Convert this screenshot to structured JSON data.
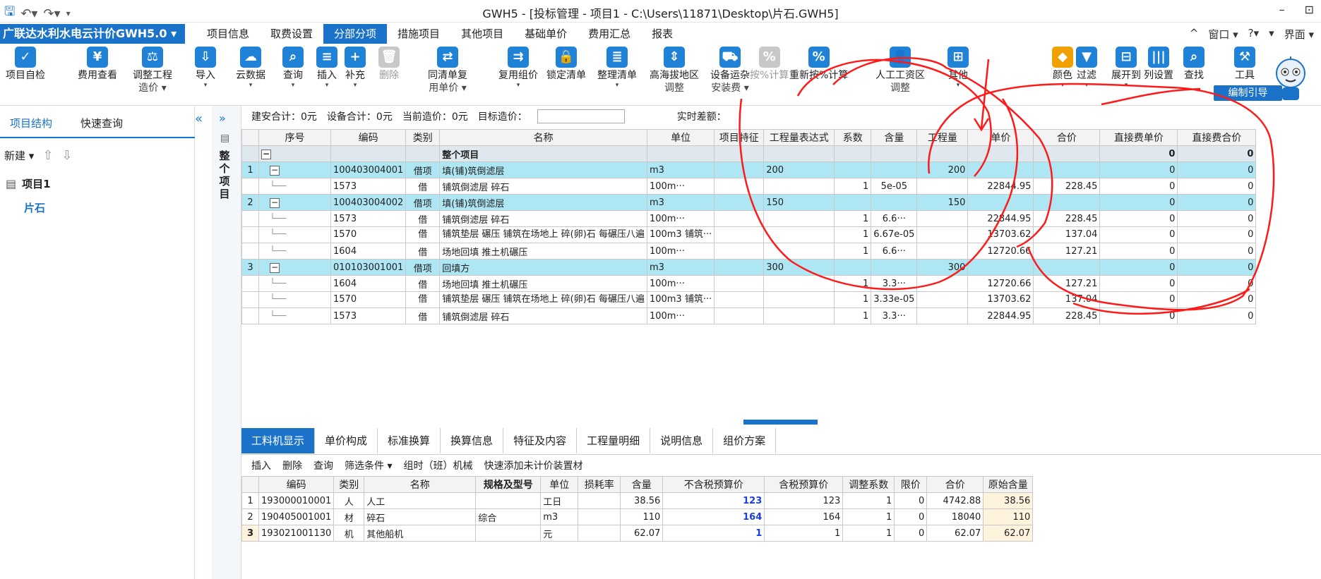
{
  "window": {
    "title": "GWH5 - [投标管理 - 项目1 - C:\\Users\\11871\\Desktop\\片石.GWH5]",
    "minimize": "–",
    "restore": "⊡"
  },
  "brand": "广联达水利水电云计价GWH5.0 ▾",
  "menu_tabs": [
    "项目信息",
    "取费设置",
    "分部分项",
    "措施项目",
    "其他项目",
    "基础单价",
    "费用汇总",
    "报表"
  ],
  "menu_active": 2,
  "menu_right": [
    "^",
    "窗口 ▾",
    "?▾",
    "▾",
    "界面 ▾"
  ],
  "toolbar": [
    {
      "label": "项目自检",
      "l2": "",
      "icon": "✓"
    },
    {
      "label": "费用查看",
      "l2": "",
      "icon": "¥"
    },
    {
      "label": "调整工程",
      "l2": "造价 ▾",
      "icon": "⚖"
    },
    {
      "label": "导入",
      "l2": "▾",
      "icon": "⇩"
    },
    {
      "label": "云数据",
      "l2": "▾",
      "icon": "☁"
    },
    {
      "label": "查询",
      "l2": "▾",
      "icon": "⌕"
    },
    {
      "label": "插入",
      "l2": "▾",
      "icon": "≡"
    },
    {
      "label": "补充",
      "l2": "▾",
      "icon": "+"
    },
    {
      "label": "删除",
      "l2": "",
      "icon": "🗑"
    },
    {
      "label": "同清单复",
      "l2": "用单价 ▾",
      "icon": "⇄"
    },
    {
      "label": "复用组价",
      "l2": "▾",
      "icon": "⇉"
    },
    {
      "label": "锁定清单",
      "l2": "",
      "icon": "🔒"
    },
    {
      "label": "整理清单",
      "l2": "▾",
      "icon": "≣"
    },
    {
      "label": "高海拔地区",
      "l2": "调整",
      "icon": "⇕"
    },
    {
      "label": "设备运杂",
      "l2": "安装费 ▾",
      "icon": "⛟"
    },
    {
      "label": "按%计算",
      "l2": "",
      "icon": "%"
    },
    {
      "label": "重新按%计算",
      "l2": "",
      "icon": "%"
    },
    {
      "label": "人工工资区",
      "l2": "调整",
      "icon": "👤"
    },
    {
      "label": "其他",
      "l2": "▾",
      "icon": "⊞"
    },
    {
      "label": "颜色",
      "l2": "▾",
      "icon": "◆"
    },
    {
      "label": "过滤",
      "l2": "▾",
      "icon": "▼"
    },
    {
      "label": "展开到",
      "l2": "▾",
      "icon": "⊟"
    },
    {
      "label": "列设置",
      "l2": "",
      "icon": "|||"
    },
    {
      "label": "查找",
      "l2": "",
      "icon": "⌕"
    },
    {
      "label": "工具",
      "l2": "",
      "icon": "⚒"
    }
  ],
  "guide": "编制引导",
  "left": {
    "tabs": [
      "项目结构",
      "快速查询"
    ],
    "new": "新建 ▾",
    "project": "项目1",
    "child": "片石"
  },
  "vertical": "整个项目",
  "sumbar": {
    "a": "建安合计：0元",
    "b": "设备合计：0元",
    "c": "当前造价：0元",
    "d": "目标造价：",
    "e": "实时差额："
  },
  "main": {
    "headers": [
      "",
      "序号",
      "编码",
      "类别",
      "名称",
      "单位",
      "项目特征",
      "工程量表达式",
      "系数",
      "含量",
      "工程量",
      "单价",
      "合价",
      "直接费单价",
      "直接费合价"
    ],
    "top": {
      "name": "整个项目",
      "d1": "0",
      "d2": "0"
    },
    "rows": [
      {
        "t": "main",
        "no": "1",
        "seq": "1",
        "code": "100403004001",
        "cat": "借项",
        "name": "填(铺)筑倒滤层",
        "unit": "m3",
        "feat": "",
        "expr": "200",
        "coef": "",
        "content": "",
        "qty": "200",
        "price": "",
        "total": "",
        "d1": "0",
        "d2": "0"
      },
      {
        "t": "sub",
        "no": "",
        "seq": "",
        "code": "1573",
        "cat": "借",
        "name": "铺筑倒滤层 碎石",
        "unit": "100m···",
        "feat": "",
        "expr": "",
        "coef": "1",
        "content": "5e-05",
        "qty": "",
        "price": "22844.95",
        "total": "228.45",
        "d1": "0",
        "d2": "0"
      },
      {
        "t": "main",
        "no": "2",
        "seq": "2",
        "code": "100403004002",
        "cat": "借项",
        "name": "填(铺)筑倒滤层",
        "unit": "m3",
        "feat": "",
        "expr": "150",
        "coef": "",
        "content": "",
        "qty": "150",
        "price": "",
        "total": "",
        "d1": "0",
        "d2": "0"
      },
      {
        "t": "sub",
        "no": "",
        "seq": "",
        "code": "1573",
        "cat": "借",
        "name": "铺筑倒滤层 碎石",
        "unit": "100m···",
        "feat": "",
        "expr": "",
        "coef": "1",
        "content": "6.6···",
        "qty": "",
        "price": "22844.95",
        "total": "228.45",
        "d1": "0",
        "d2": "0"
      },
      {
        "t": "tall",
        "no": "",
        "seq": "",
        "code": "1570",
        "cat": "借",
        "name": "铺筑垫层 碾压 铺筑在场地上 碎(卵)石 每碾压八遍",
        "unit": "100m3 铺筑···",
        "feat": "",
        "expr": "",
        "coef": "1",
        "content": "6.67e-05",
        "qty": "",
        "price": "13703.62",
        "total": "137.04",
        "d1": "0",
        "d2": "0"
      },
      {
        "t": "sub",
        "no": "",
        "seq": "",
        "code": "1604",
        "cat": "借",
        "name": "场地回填 推土机碾压",
        "unit": "100m···",
        "feat": "",
        "expr": "",
        "coef": "1",
        "content": "6.6···",
        "qty": "",
        "price": "12720.66",
        "total": "127.21",
        "d1": "0",
        "d2": "0"
      },
      {
        "t": "main",
        "no": "3",
        "seq": "3",
        "code": "010103001001",
        "cat": "借项",
        "name": "回填方",
        "unit": "m3",
        "feat": "",
        "expr": "300",
        "coef": "",
        "content": "",
        "qty": "300",
        "price": "",
        "total": "",
        "d1": "0",
        "d2": "0"
      },
      {
        "t": "sub",
        "no": "",
        "seq": "",
        "code": "1604",
        "cat": "借",
        "name": "场地回填 推土机碾压",
        "unit": "100m···",
        "feat": "",
        "expr": "",
        "coef": "1",
        "content": "3.3···",
        "qty": "",
        "price": "12720.66",
        "total": "127.21",
        "d1": "0",
        "d2": "0"
      },
      {
        "t": "tall",
        "no": "",
        "seq": "",
        "code": "1570",
        "cat": "借",
        "name": "铺筑垫层 碾压 铺筑在场地上 碎(卵)石 每碾压八遍",
        "unit": "100m3 铺筑···",
        "feat": "",
        "expr": "",
        "coef": "1",
        "content": "3.33e-05",
        "qty": "",
        "price": "13703.62",
        "total": "137.04",
        "d1": "0",
        "d2": "0"
      },
      {
        "t": "sub",
        "no": "",
        "seq": "",
        "code": "1573",
        "cat": "借",
        "name": "铺筑倒滤层 碎石",
        "unit": "100m···",
        "feat": "",
        "expr": "",
        "coef": "1",
        "content": "3.3···",
        "qty": "",
        "price": "22844.95",
        "total": "228.45",
        "d1": "0",
        "d2": "0"
      }
    ]
  },
  "bottom": {
    "tabs": [
      "工料机显示",
      "单价构成",
      "标准换算",
      "换算信息",
      "特征及内容",
      "工程量明细",
      "说明信息",
      "组价方案"
    ],
    "menu": [
      "插入",
      "删除",
      "查询",
      "筛选条件 ▾",
      "组时（班）机械",
      "快速添加未计价装置材"
    ],
    "headers": [
      "",
      "编码",
      "类别",
      "名称",
      "规格及型号",
      "单位",
      "损耗率",
      "含量",
      "不含税预算价",
      "含税预算价",
      "调整系数",
      "限价",
      "合价",
      "原始含量"
    ],
    "rows": [
      {
        "no": "1",
        "code": "193000010001",
        "cat": "人",
        "name": "人工",
        "spec": "",
        "unit": "工日",
        "loss": "",
        "content": "38.56",
        "pre": "123",
        "tax": "123",
        "adj": "1",
        "lim": "0",
        "total": "4742.88",
        "orig": "38.56"
      },
      {
        "no": "2",
        "code": "190405001001",
        "cat": "材",
        "name": "碎石",
        "spec": "综合",
        "unit": "m3",
        "loss": "",
        "content": "110",
        "pre": "164",
        "tax": "164",
        "adj": "1",
        "lim": "0",
        "total": "18040",
        "orig": "110"
      },
      {
        "no": "3",
        "code": "193021001130",
        "cat": "机",
        "name": "其他船机",
        "spec": "",
        "unit": "元",
        "loss": "",
        "content": "62.07",
        "pre": "1",
        "tax": "1",
        "adj": "1",
        "lim": "0",
        "total": "62.07",
        "orig": "62.07"
      }
    ]
  },
  "colors": {
    "accent": "#1a73c8",
    "rowhl": "#aee6f4",
    "annotation": "#ff1a1a"
  }
}
